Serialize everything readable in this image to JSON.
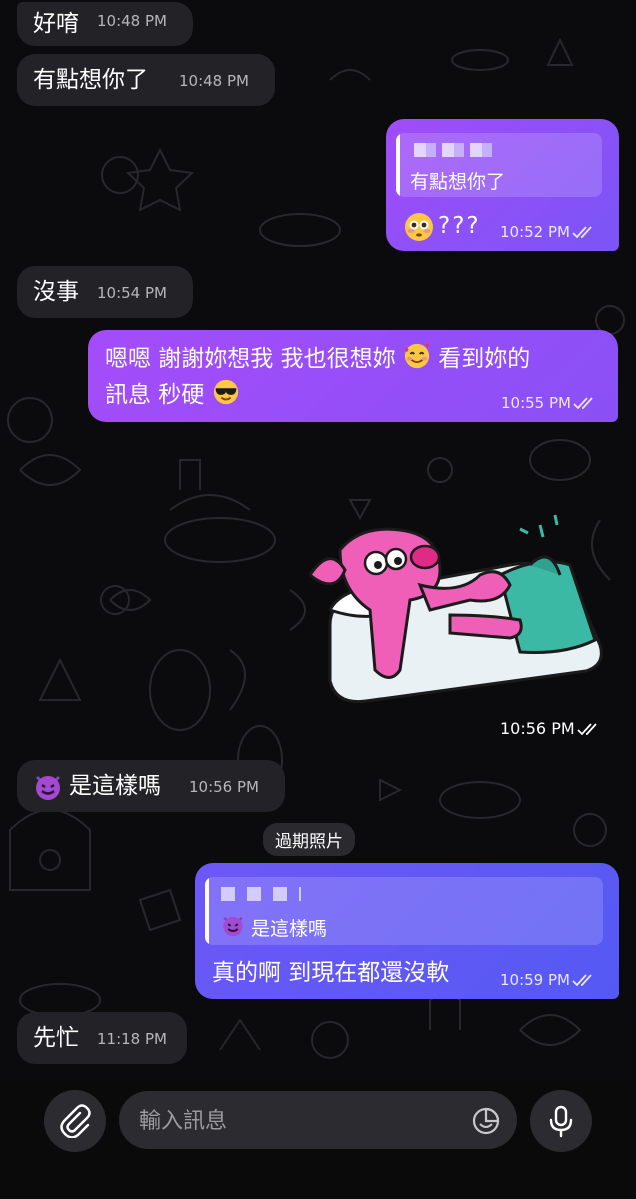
{
  "theme": {
    "background": "#0b0b0d",
    "incoming_bubble": "#232327",
    "outgoing_gradient_start": "#a44dfb",
    "outgoing_gradient_end": "#6b57f5",
    "outgoing_blue": "#5b5ef5"
  },
  "messages": [
    {
      "id": "m1",
      "direction": "incoming",
      "text": "好唷",
      "time": "10:48 PM"
    },
    {
      "id": "m2",
      "direction": "incoming",
      "text": "有點想你了",
      "time": "10:48 PM"
    },
    {
      "id": "m3",
      "direction": "outgoing",
      "reply_to_text": "有點想你了",
      "text": "???",
      "emoji": "flushed-face",
      "time": "10:52 PM",
      "status": "read"
    },
    {
      "id": "m4",
      "direction": "incoming",
      "text": "沒事",
      "time": "10:54 PM"
    },
    {
      "id": "m5",
      "direction": "outgoing",
      "line1": "嗯嗯 謝謝妳想我 我也很想妳",
      "line1_after": "看到妳的",
      "line2": "訊息 秒硬",
      "emoji1": "smiling-face-with-hearts",
      "emoji2": "sunglasses-face",
      "time": "10:55 PM",
      "status": "read"
    },
    {
      "id": "m6",
      "direction": "outgoing",
      "type": "sticker",
      "sticker": "pink-dog-in-bed",
      "time": "10:56 PM",
      "status": "read"
    },
    {
      "id": "m7",
      "direction": "incoming",
      "emoji": "smiling-imp",
      "text": "是這樣嗎",
      "time": "10:56 PM"
    },
    {
      "id": "m8",
      "direction": "outgoing",
      "reply_to_emoji": "smiling-imp",
      "reply_to_text": "是這樣嗎",
      "text": "真的啊 到現在都還沒軟",
      "time": "10:59 PM",
      "status": "read"
    },
    {
      "id": "m9",
      "direction": "incoming",
      "text": "先忙",
      "time": "11:18 PM"
    }
  ],
  "service_message": "過期照片",
  "composer": {
    "placeholder": "輸入訊息",
    "attach_icon": "paperclip-icon",
    "sticker_icon": "sticker-icon",
    "mic_icon": "microphone-icon"
  }
}
